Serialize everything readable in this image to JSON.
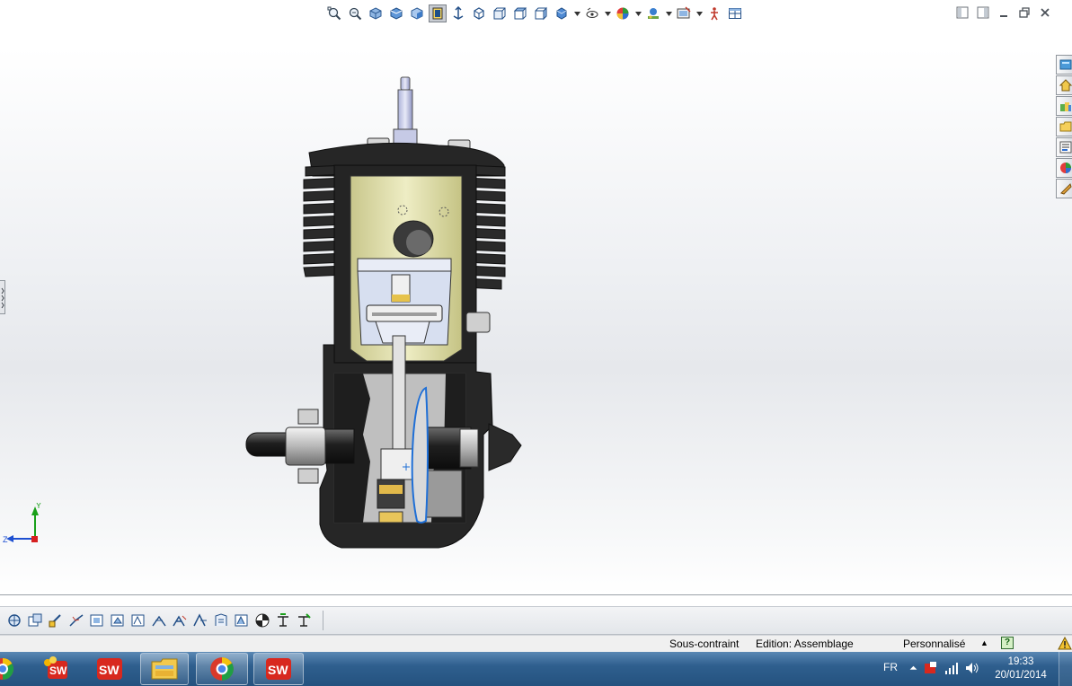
{
  "heads_up_toolbar": {
    "buttons": [
      "zoom-to-fit",
      "zoom-to-area",
      "previous-view",
      "section-view",
      "view-orientation",
      "dynamic-annotation",
      "display-style",
      "hide-show-items",
      "edit-appearance",
      "apply-scene",
      "view-settings",
      "rotate-view",
      "tile-views"
    ]
  },
  "window_controls": [
    "restore-pane",
    "restore-pane-2",
    "minimize",
    "restore",
    "close"
  ],
  "task_pane": {
    "tabs": [
      "solidworks-resources",
      "design-library",
      "file-explorer",
      "view-palette",
      "appearances-scenes",
      "custom-properties",
      "extra"
    ]
  },
  "triad": {
    "x_label": "",
    "y_label": "Y",
    "z_label": "Z"
  },
  "command_bar": {
    "buttons": [
      "smart-mates",
      "insert-components",
      "mate",
      "linear-pattern",
      "smart-fasteners",
      "move-component",
      "show-hidden",
      "assembly-features",
      "reference-geometry",
      "new-motion-study",
      "bill-of-materials",
      "exploded-view",
      "explode-line-sketch",
      "interference-detection"
    ]
  },
  "status_bar": {
    "definition": "Sous-contraint",
    "mode": "Edition: Assemblage",
    "units": "Personnalisé",
    "help": "?"
  },
  "taskbar": {
    "apps": [
      "chrome",
      "solidworks-explorer",
      "solidworks",
      "windows-explorer",
      "chrome",
      "solidworks"
    ],
    "language": "FR",
    "time": "19:33",
    "date": "20/01/2014"
  },
  "colors": {
    "engine_body": "#2a2a2a",
    "cylinder_liner": "#e5e4b4",
    "taskbar": "#2f5f8e",
    "selection_outline": "#1f6fd6"
  }
}
